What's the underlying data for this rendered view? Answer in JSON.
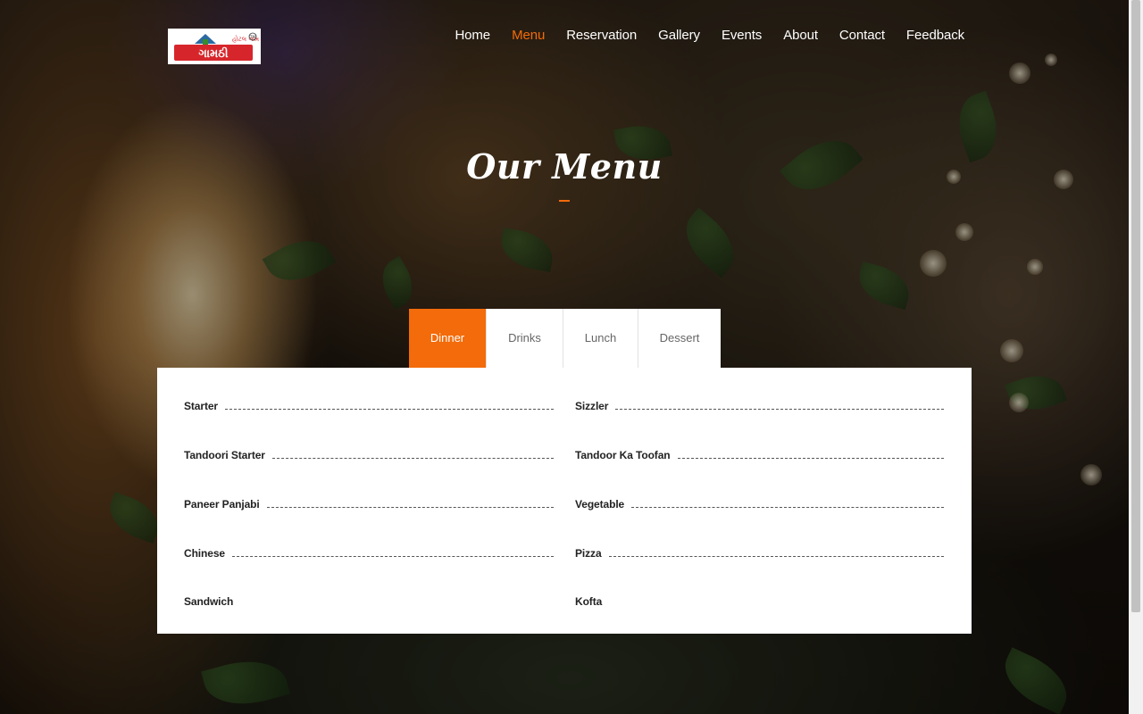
{
  "brand": {
    "logo_text": "હોટલ ગામઠી",
    "logo_badge": "TM"
  },
  "nav": {
    "items": [
      {
        "label": "Home"
      },
      {
        "label": "Menu",
        "active": true
      },
      {
        "label": "Reservation"
      },
      {
        "label": "Gallery"
      },
      {
        "label": "Events"
      },
      {
        "label": "About"
      },
      {
        "label": "Contact"
      },
      {
        "label": "Feedback"
      }
    ]
  },
  "section": {
    "title": "Our Menu"
  },
  "tabs": [
    {
      "label": "Dinner",
      "active": true
    },
    {
      "label": "Drinks"
    },
    {
      "label": "Lunch"
    },
    {
      "label": "Dessert"
    }
  ],
  "menu": {
    "left": [
      {
        "name": "Starter"
      },
      {
        "name": "Tandoori Starter"
      },
      {
        "name": "Paneer Panjabi"
      },
      {
        "name": "Chinese"
      },
      {
        "name": "Sandwich"
      }
    ],
    "right": [
      {
        "name": "Sizzler"
      },
      {
        "name": "Tandoor Ka Toofan"
      },
      {
        "name": "Vegetable"
      },
      {
        "name": "Pizza"
      },
      {
        "name": "Kofta"
      }
    ]
  },
  "colors": {
    "accent": "#f36b0a",
    "panel": "#ffffff",
    "text": "#222222",
    "logo_red": "#d7262b"
  }
}
